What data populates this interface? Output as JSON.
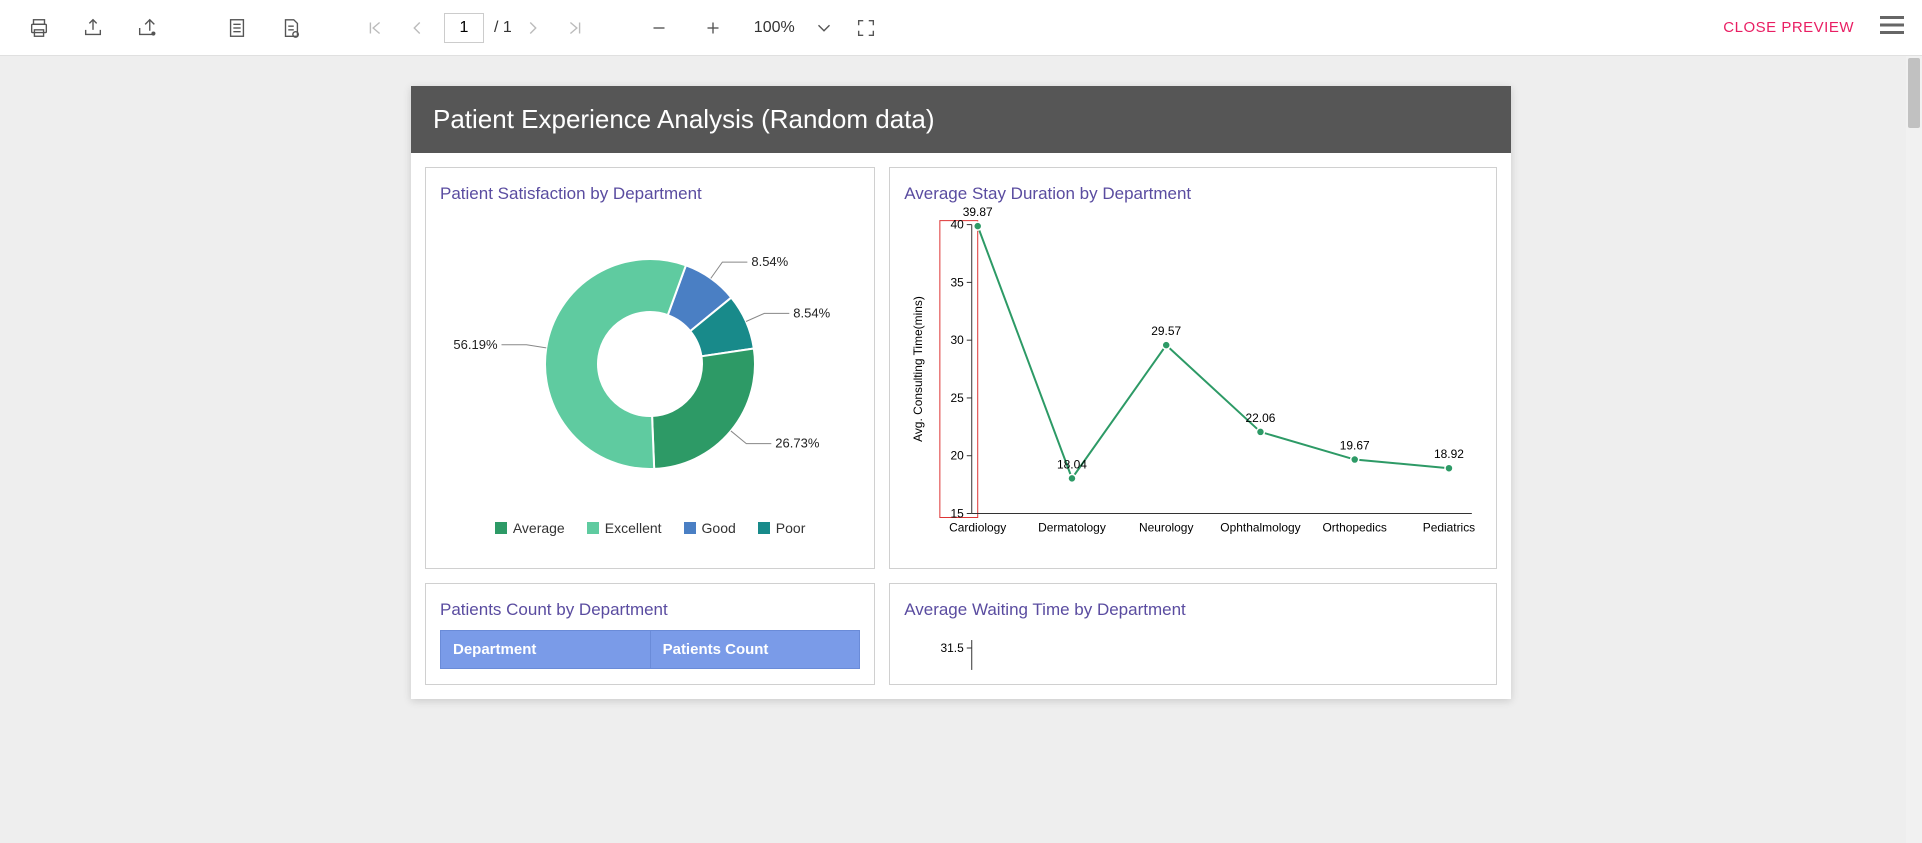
{
  "toolbar": {
    "page_current": "1",
    "page_total": "/ 1",
    "zoom": "100%",
    "close": "CLOSE PREVIEW"
  },
  "report": {
    "title": "Patient Experience Analysis (Random data)"
  },
  "card1": {
    "title": "Patient Satisfaction by Department",
    "legend": [
      "Average",
      "Excellent",
      "Good",
      "Poor"
    ]
  },
  "card2": {
    "title": "Average Stay Duration by Department",
    "ylabel": "Avg. Consulting Time(mins)"
  },
  "card3": {
    "title": "Patients Count by Department",
    "headers": [
      "Department",
      "Patients Count"
    ]
  },
  "card4": {
    "title": "Average Waiting Time by Department"
  },
  "chart_data": [
    {
      "type": "pie",
      "title": "Patient Satisfaction by Department",
      "series": [
        {
          "name": "Excellent",
          "value": 56.19,
          "color": "#5fcba0"
        },
        {
          "name": "Average",
          "value": 26.73,
          "color": "#2d9a66"
        },
        {
          "name": "Poor",
          "value": 8.54,
          "color": "#188a8a"
        },
        {
          "name": "Good",
          "value": 8.54,
          "color": "#4a7fc4"
        }
      ],
      "labels": [
        "56.19%",
        "26.73%",
        "8.54%",
        "8.54%"
      ]
    },
    {
      "type": "line",
      "title": "Average Stay Duration by Department",
      "ylabel": "Avg. Consulting Time(mins)",
      "categories": [
        "Cardiology",
        "Dermatology",
        "Neurology",
        "Ophthalmology",
        "Orthopedics",
        "Pediatrics"
      ],
      "values": [
        39.87,
        18.04,
        29.57,
        22.06,
        19.67,
        18.92
      ],
      "ylim": [
        15,
        40
      ],
      "yticks": [
        15,
        20,
        25,
        30,
        35,
        40
      ]
    },
    {
      "type": "table",
      "title": "Patients Count by Department",
      "columns": [
        "Department",
        "Patients Count"
      ]
    },
    {
      "type": "line",
      "title": "Average Waiting Time by Department",
      "yticks_partial": [
        31.5
      ]
    }
  ]
}
